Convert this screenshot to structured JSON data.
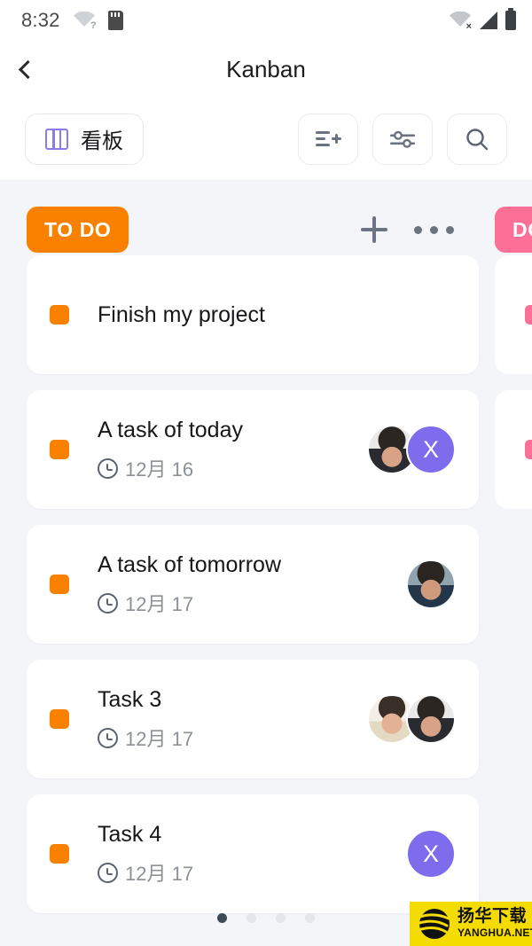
{
  "status_bar": {
    "time": "8:32",
    "left_icons": [
      "wifi-question-icon",
      "sd-card-icon"
    ],
    "right_icons": [
      "wifi-disconnected-icon",
      "cellular-signal-icon",
      "battery-icon"
    ]
  },
  "header": {
    "back_icon": "chevron-left-icon",
    "title": "Kanban"
  },
  "toolbar": {
    "view_chip": {
      "icon": "board-columns-icon",
      "label": "看板"
    },
    "buttons": [
      {
        "name": "add-list-button",
        "icon": "list-plus-icon"
      },
      {
        "name": "filter-button",
        "icon": "sliders-icon"
      },
      {
        "name": "search-button",
        "icon": "search-icon"
      }
    ]
  },
  "board": {
    "columns": [
      {
        "title": "TO DO",
        "color": "#FA8100",
        "actions": [
          {
            "name": "add-card-button",
            "icon": "plus-icon"
          },
          {
            "name": "column-menu-button",
            "icon": "more-horizontal-icon"
          }
        ],
        "cards": [
          {
            "title": "Finish my project",
            "tag_color": "#FA8100",
            "date": "",
            "avatars": []
          },
          {
            "title": "A task of today",
            "tag_color": "#FA8100",
            "date": "12月 16",
            "avatars": [
              {
                "type": "photo",
                "face": "face1"
              },
              {
                "type": "initial",
                "label": "X",
                "color": "#7D6CEC"
              }
            ]
          },
          {
            "title": "A task of tomorrow",
            "tag_color": "#FA8100",
            "date": "12月 17",
            "avatars": [
              {
                "type": "photo",
                "face": "face2"
              }
            ]
          },
          {
            "title": "Task 3",
            "tag_color": "#FA8100",
            "date": "12月 17",
            "avatars": [
              {
                "type": "photo",
                "face": "face3"
              },
              {
                "type": "photo",
                "face": "face1"
              }
            ]
          },
          {
            "title": "Task 4",
            "tag_color": "#FA8100",
            "date": "12月 17",
            "avatars": [
              {
                "type": "initial",
                "label": "X",
                "color": "#7D6CEC"
              }
            ]
          }
        ]
      },
      {
        "title": "DO",
        "color": "#FC6F96",
        "actions": [],
        "cards": [
          {
            "title": "",
            "tag_color": "#FC6F96",
            "date": "",
            "avatars": []
          },
          {
            "title": "",
            "tag_color": "#FC6F96",
            "date": "",
            "avatars": []
          }
        ]
      }
    ],
    "clock_icon": "clock-icon"
  },
  "pagination": {
    "total": 4,
    "active_index": 0
  },
  "watermark": {
    "cn": "扬华下载",
    "en": "YANGHUA.NET"
  }
}
